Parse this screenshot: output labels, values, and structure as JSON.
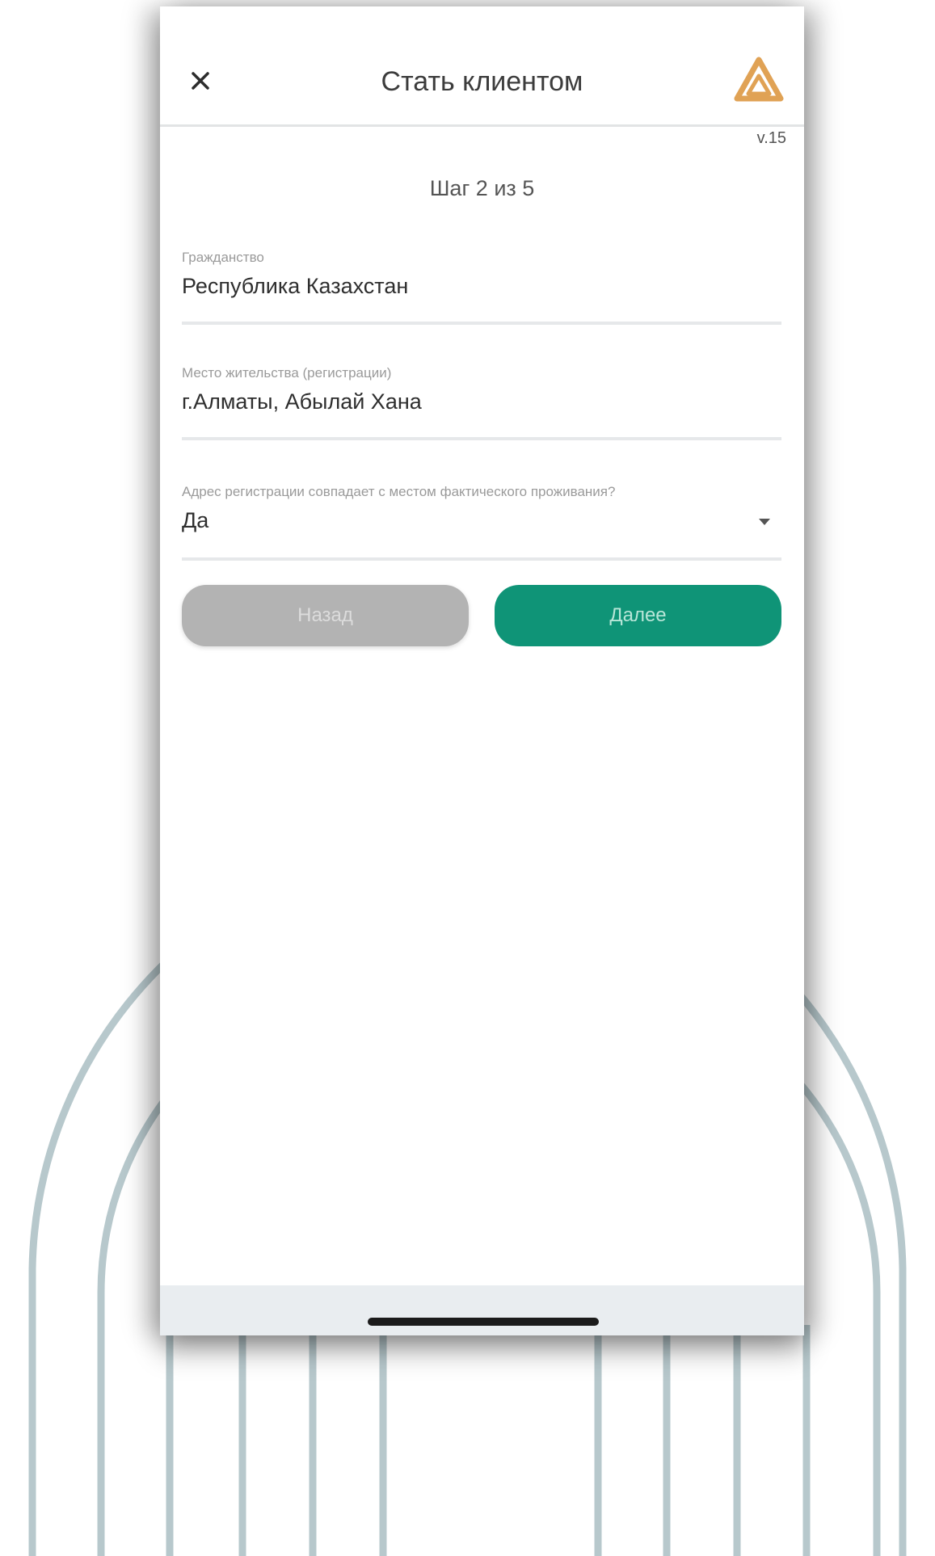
{
  "header": {
    "title": "Стать клиентом",
    "close_icon": "close-icon",
    "logo_icon": "bank-logo-icon"
  },
  "version": "v.15",
  "step": "Шаг 2 из 5",
  "form": {
    "citizenship": {
      "label": "Гражданство",
      "value": "Республика Казахстан"
    },
    "residence": {
      "label": "Место жительства (регистрации)",
      "value": "г.Алматы, Абылай Хана"
    },
    "address_match": {
      "label": "Адрес регистрации совпадает с местом фактического проживания?",
      "value": "Да"
    }
  },
  "buttons": {
    "back_label": "Назад",
    "next_label": "Далее"
  },
  "colors": {
    "accent": "#0f9477",
    "logo": "#e0a255",
    "disabled_button": "#b3b3b3"
  }
}
